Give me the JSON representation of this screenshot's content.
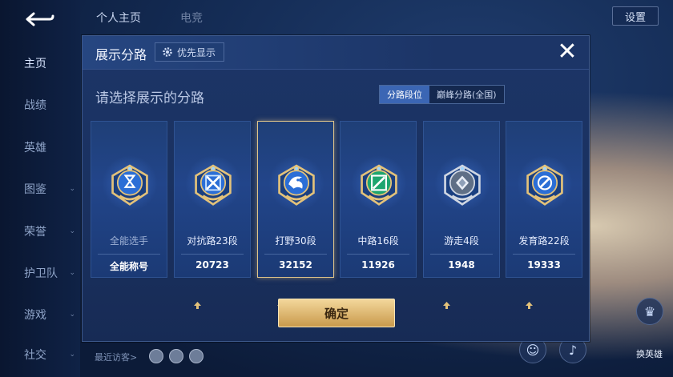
{
  "sidebar": {
    "items": [
      {
        "label": "主页",
        "chevron": false
      },
      {
        "label": "战绩",
        "chevron": false
      },
      {
        "label": "英雄",
        "chevron": false
      },
      {
        "label": "图鉴",
        "chevron": true
      },
      {
        "label": "荣誉",
        "chevron": true
      },
      {
        "label": "护卫队",
        "chevron": true
      },
      {
        "label": "游戏",
        "chevron": true
      },
      {
        "label": "社交",
        "chevron": true
      }
    ]
  },
  "top": {
    "tab1": "个人主页",
    "tab2": "电竞",
    "settings": "设置"
  },
  "footer": {
    "visitors_label": "最近访客>"
  },
  "right_buttons": {
    "hero_label": "换英雄",
    "top_label": "荣耀"
  },
  "dialog": {
    "title": "展示分路",
    "priority_label": "优先显示",
    "close_symbol": "✕",
    "prompt": "请选择展示的分路",
    "seg_on": "分路段位",
    "seg_off": "巅峰分路(全国)",
    "confirm": "确定",
    "cards": [
      {
        "name": "全能选手",
        "value": "全能称号",
        "icon": "all-round-emblem",
        "selected": false,
        "arrow": false
      },
      {
        "name": "对抗路23段",
        "value": "20723",
        "icon": "clash-lane-emblem",
        "selected": false,
        "arrow": true
      },
      {
        "name": "打野30段",
        "value": "32152",
        "icon": "jungle-emblem",
        "selected": true,
        "arrow": true
      },
      {
        "name": "中路16段",
        "value": "11926",
        "icon": "mid-lane-emblem",
        "selected": false,
        "arrow": true
      },
      {
        "name": "游走4段",
        "value": "1948",
        "icon": "roam-emblem",
        "selected": false,
        "arrow": true
      },
      {
        "name": "发育路22段",
        "value": "19333",
        "icon": "farm-lane-emblem",
        "selected": false,
        "arrow": true
      }
    ]
  },
  "colors": {
    "accent": "#3b66b4",
    "gold": "#e0c58a",
    "panel": "#1c3567"
  }
}
